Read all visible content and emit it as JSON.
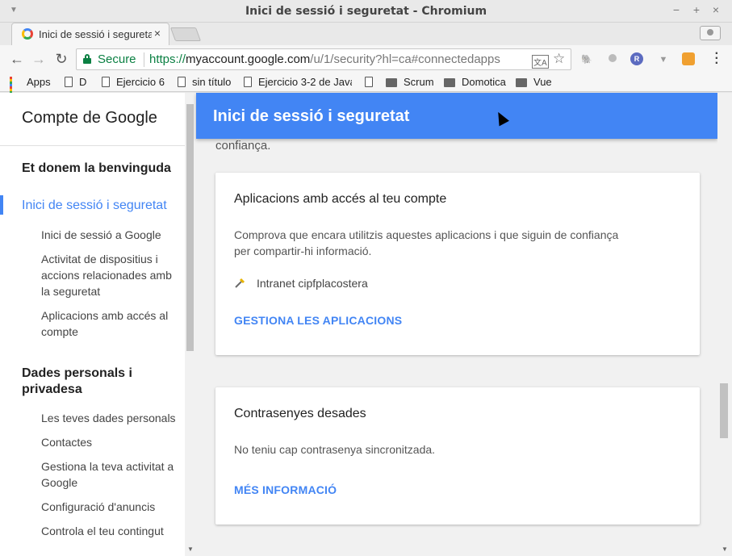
{
  "window": {
    "title": "Inici de sessió i seguretat - Chromium",
    "minimize": "−",
    "maximize": "+",
    "close": "×"
  },
  "tab": {
    "label": "Inici de sessió i seguretat",
    "close": "×"
  },
  "toolbar": {
    "back": "←",
    "forward": "→",
    "reload": "↻",
    "secure_label": "Secure",
    "url_scheme": "https://",
    "url_host": "myaccount.google.com",
    "url_path": "/u/1/security?hl=ca#connectedapps",
    "star": "☆",
    "translate": "文A",
    "menu": "⋮"
  },
  "bookmarks": [
    {
      "label": "Apps",
      "icon": "apps-grid-icon"
    },
    {
      "label": "D",
      "icon": "document-icon"
    },
    {
      "label": "Ejercicio 6",
      "icon": "document-icon"
    },
    {
      "label": "sin título",
      "icon": "document-icon"
    },
    {
      "label": "Ejercicio 3-2 de Java",
      "icon": "document-icon"
    },
    {
      "label": "",
      "icon": "document-icon"
    },
    {
      "label": "Scrum",
      "icon": "folder-icon"
    },
    {
      "label": "Domotica",
      "icon": "folder-icon"
    },
    {
      "label": "Vue",
      "icon": "folder-icon"
    }
  ],
  "sidebar": {
    "brand": "Compte de Google",
    "sections": [
      {
        "label": "Et donem la benvinguda"
      },
      {
        "label": "Inici de sessió i seguretat",
        "active": true
      },
      {
        "label": "Dades personals i privadesa"
      }
    ],
    "security_items": [
      "Inici de sessió a Google",
      "Activitat de dispositius i accions relacionades amb la seguretat",
      "Aplicacions amb accés al compte"
    ],
    "privacy_items": [
      "Les teves dades personals",
      "Contactes",
      "Gestiona la teva activitat a Google",
      "Configuració d'anuncis",
      "Controla el teu contingut"
    ]
  },
  "main": {
    "header_title": "Inici de sessió i seguretat",
    "trailing_text": "confiança.",
    "apps_card": {
      "title": "Aplicacions amb accés al teu compte",
      "description": "Comprova que encara utilitzis aquestes aplicacions i que siguin de confiança per compartir-hi informació.",
      "app_name": "Intranet cipfplacostera",
      "link": "GESTIONA LES APLICACIONS"
    },
    "passwords_card": {
      "title": "Contrasenyes desades",
      "description": "No teniu cap contrasenya sincronitzada.",
      "link": "MÉS INFORMACIÓ"
    }
  },
  "colors": {
    "accent": "#4285f4",
    "secure_green": "#0b8043"
  }
}
